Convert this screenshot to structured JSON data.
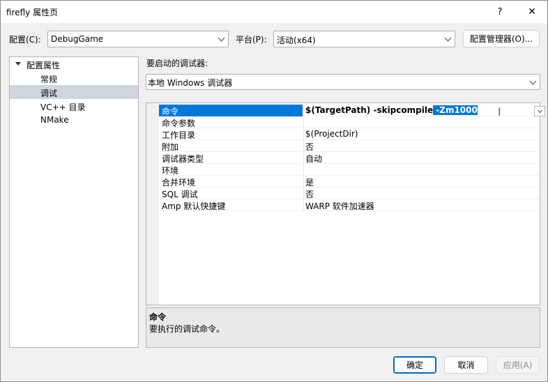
{
  "window": {
    "title": "firefly 属性页",
    "help_glyph": "?",
    "close_glyph": "✕"
  },
  "config": {
    "label": "配置(C):",
    "value": "DebugGame"
  },
  "platform": {
    "label": "平台(P):",
    "value": "活动(x64)"
  },
  "config_manager_label": "配置管理器(O)...",
  "tree": {
    "root": "配置属性",
    "items": [
      "常规",
      "调试",
      "VC++ 目录",
      "NMake"
    ],
    "selected": "调试"
  },
  "debugger": {
    "label": "要启动的调试器:",
    "value": "本地 Windows 调试器"
  },
  "properties": [
    {
      "name": "命令",
      "value_prefix": "$(TargetPath) -skipcompile",
      "value_selected": " -Zm1000",
      "value": ""
    },
    {
      "name": "命令参数",
      "value": ""
    },
    {
      "name": "工作目录",
      "value": "$(ProjectDir)"
    },
    {
      "name": "附加",
      "value": "否"
    },
    {
      "name": "调试器类型",
      "value": "自动"
    },
    {
      "name": "环境",
      "value": ""
    },
    {
      "name": "合并环境",
      "value": "是"
    },
    {
      "name": "SQL 调试",
      "value": "否"
    },
    {
      "name": "Amp 默认快捷键",
      "value": "WARP 软件加速器"
    }
  ],
  "description": {
    "title": "命令",
    "text": "要执行的调试命令。"
  },
  "buttons": {
    "ok": "确定",
    "cancel": "取消",
    "apply": "应用(A)"
  },
  "colors": {
    "selection": "#0078d7",
    "tree_selected": "#cfd5e0",
    "primary_border": "#0067c0"
  }
}
